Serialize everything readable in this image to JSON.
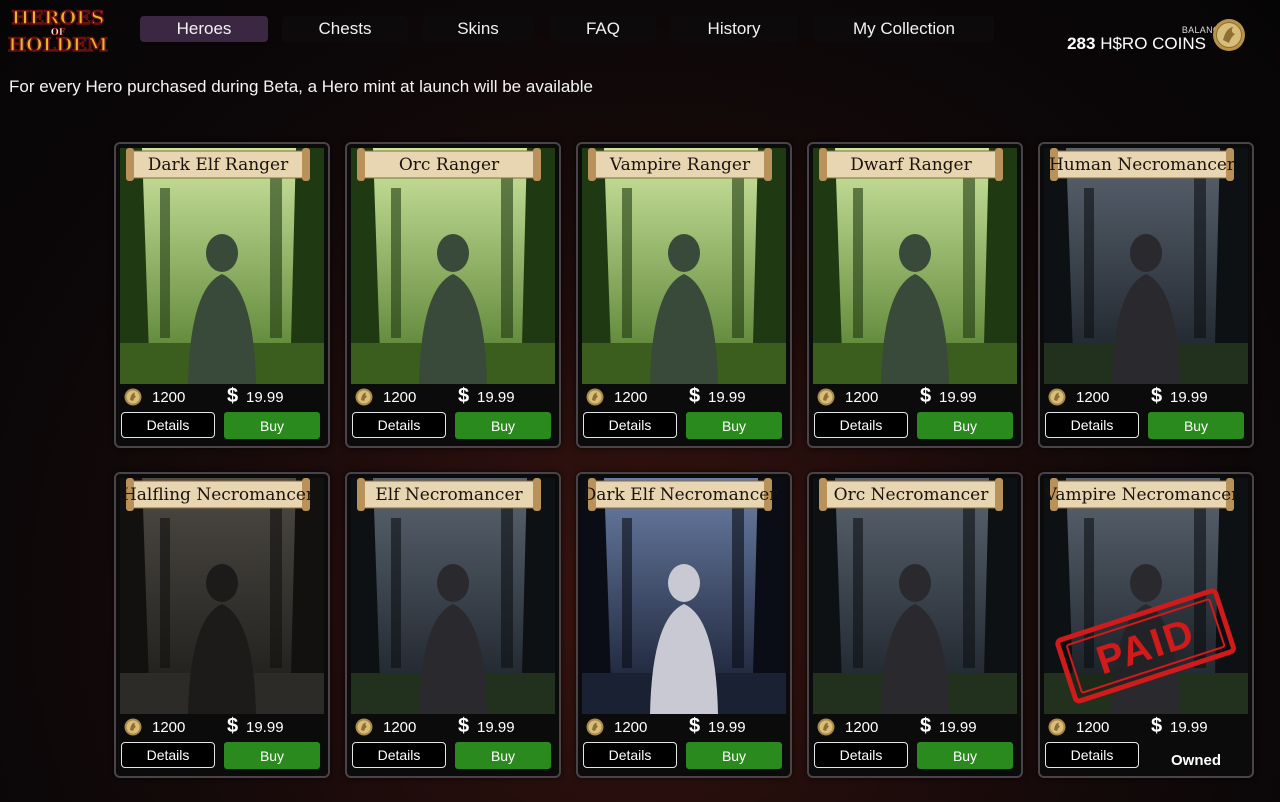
{
  "logo": {
    "line1": "HEROES",
    "line2": "OF",
    "line3": "HOLDEM"
  },
  "nav": {
    "tabs": [
      {
        "label": "Heroes",
        "active": true
      },
      {
        "label": "Chests",
        "active": false
      },
      {
        "label": "Skins",
        "active": false
      },
      {
        "label": "FAQ",
        "active": false
      },
      {
        "label": "History",
        "active": false
      },
      {
        "label": "My Collection",
        "active": false
      }
    ]
  },
  "balance": {
    "caption": "BALANCE",
    "amount": "283",
    "currency": "H$RO COINS"
  },
  "notice": "For every Hero purchased during Beta, a Hero mint at launch will be available",
  "colors": {
    "accent_tab": "#3b2741",
    "buy_green": "#2a8a1d",
    "paid_red": "#d11a1a",
    "scroll_parchment": "#e8d6b2"
  },
  "cards": [
    {
      "name": "Dark Elf Ranger",
      "coins": "1200",
      "usd": "$",
      "price": "19.99",
      "details_label": "Details",
      "action_label": "Buy",
      "owned": false,
      "scene": "forest"
    },
    {
      "name": "Orc Ranger",
      "coins": "1200",
      "usd": "$",
      "price": "19.99",
      "details_label": "Details",
      "action_label": "Buy",
      "owned": false,
      "scene": "forest"
    },
    {
      "name": "Vampire Ranger",
      "coins": "1200",
      "usd": "$",
      "price": "19.99",
      "details_label": "Details",
      "action_label": "Buy",
      "owned": false,
      "scene": "forest"
    },
    {
      "name": "Dwarf Ranger",
      "coins": "1200",
      "usd": "$",
      "price": "19.99",
      "details_label": "Details",
      "action_label": "Buy",
      "owned": false,
      "scene": "forest"
    },
    {
      "name": "Human Necromancer",
      "coins": "1200",
      "usd": "$",
      "price": "19.99",
      "details_label": "Details",
      "action_label": "Buy",
      "owned": false,
      "scene": "graveyard"
    },
    {
      "name": "Halfling Necromancer",
      "coins": "1200",
      "usd": "$",
      "price": "19.99",
      "details_label": "Details",
      "action_label": "Buy",
      "owned": false,
      "scene": "dungeon"
    },
    {
      "name": "Elf Necromancer",
      "coins": "1200",
      "usd": "$",
      "price": "19.99",
      "details_label": "Details",
      "action_label": "Buy",
      "owned": false,
      "scene": "graveyard"
    },
    {
      "name": "Dark Elf Necromancer",
      "coins": "1200",
      "usd": "$",
      "price": "19.99",
      "details_label": "Details",
      "action_label": "Buy",
      "owned": false,
      "scene": "night"
    },
    {
      "name": "Orc Necromancer",
      "coins": "1200",
      "usd": "$",
      "price": "19.99",
      "details_label": "Details",
      "action_label": "Buy",
      "owned": false,
      "scene": "graveyard"
    },
    {
      "name": "Vampire Necromancer",
      "coins": "1200",
      "usd": "$",
      "price": "19.99",
      "details_label": "Details",
      "action_label": "Owned",
      "owned": true,
      "stamp_text": "PAID",
      "scene": "graveyard"
    }
  ]
}
